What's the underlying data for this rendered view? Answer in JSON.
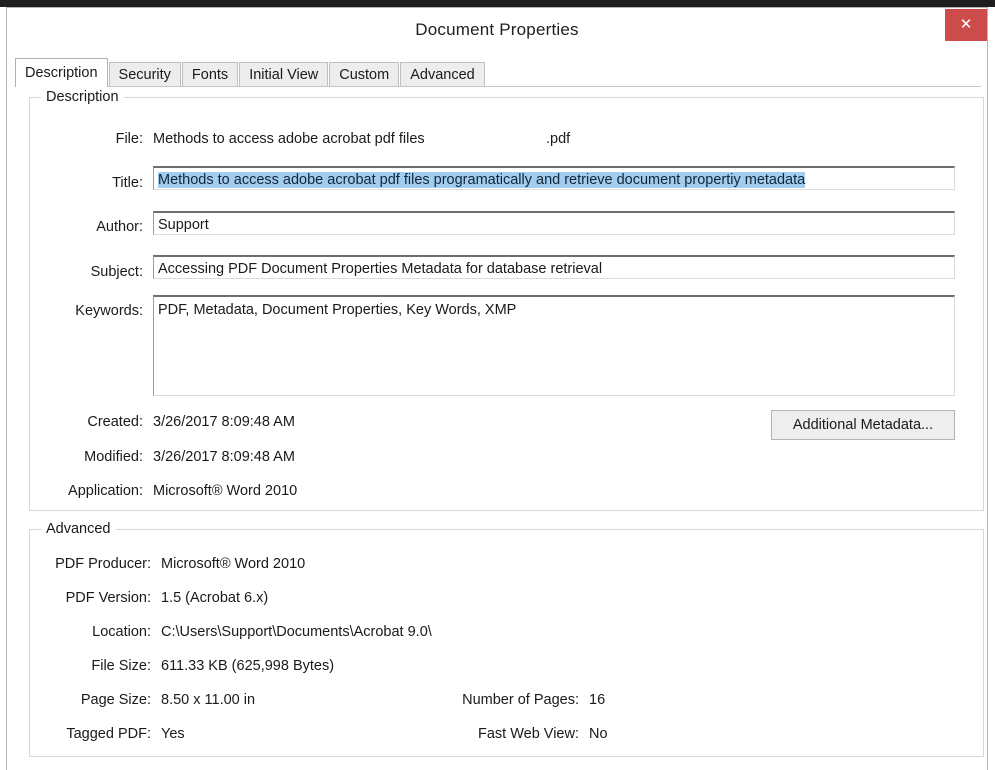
{
  "window": {
    "title": "Document Properties",
    "close_label": "✕"
  },
  "tabs": [
    {
      "label": "Description",
      "active": true
    },
    {
      "label": "Security",
      "active": false
    },
    {
      "label": "Fonts",
      "active": false
    },
    {
      "label": "Initial View",
      "active": false
    },
    {
      "label": "Custom",
      "active": false
    },
    {
      "label": "Advanced",
      "active": false
    }
  ],
  "description": {
    "group_label": "Description",
    "file": {
      "label": "File:",
      "value": "Methods to access adobe acrobat pdf files",
      "extension": ".pdf"
    },
    "title": {
      "label": "Title:",
      "value": "Methods to access adobe acrobat pdf files programatically and retrieve document propertiy metadata",
      "placeholder": "",
      "selected": true
    },
    "author": {
      "label": "Author:",
      "value": "Support",
      "placeholder": ""
    },
    "subject": {
      "label": "Subject:",
      "value": "Accessing PDF Document Properties Metadata for database retrieval",
      "placeholder": ""
    },
    "keywords": {
      "label": "Keywords:",
      "value": "PDF, Metadata, Document Properties, Key Words, XMP",
      "placeholder": ""
    },
    "created": {
      "label": "Created:",
      "value": "3/26/2017 8:09:48 AM"
    },
    "modified": {
      "label": "Modified:",
      "value": "3/26/2017 8:09:48 AM"
    },
    "application": {
      "label": "Application:",
      "value": "Microsoft® Word 2010"
    },
    "additional_metadata_button": "Additional Metadata..."
  },
  "advanced": {
    "group_label": "Advanced",
    "pdf_producer": {
      "label": "PDF Producer:",
      "value": "Microsoft® Word 2010"
    },
    "pdf_version": {
      "label": "PDF Version:",
      "value": "1.5 (Acrobat 6.x)"
    },
    "location": {
      "label": "Location:",
      "value": "C:\\Users\\Support\\Documents\\Acrobat 9.0\\"
    },
    "file_size": {
      "label": "File Size:",
      "value": "611.33 KB (625,998 Bytes)"
    },
    "page_size": {
      "label": "Page Size:",
      "value": "8.50 x 11.00 in"
    },
    "tagged_pdf": {
      "label": "Tagged PDF:",
      "value": "Yes"
    },
    "number_of_pages": {
      "label": "Number of Pages:",
      "value": "16"
    },
    "fast_web_view": {
      "label": "Fast Web View:",
      "value": "No"
    }
  },
  "colors": {
    "close_button": "#cc4c4c",
    "selection_highlight": "#a3cdef",
    "tab_active_bg": "#ffffff",
    "tab_inactive_bg": "#ededed",
    "group_border": "#d8d8d8"
  }
}
